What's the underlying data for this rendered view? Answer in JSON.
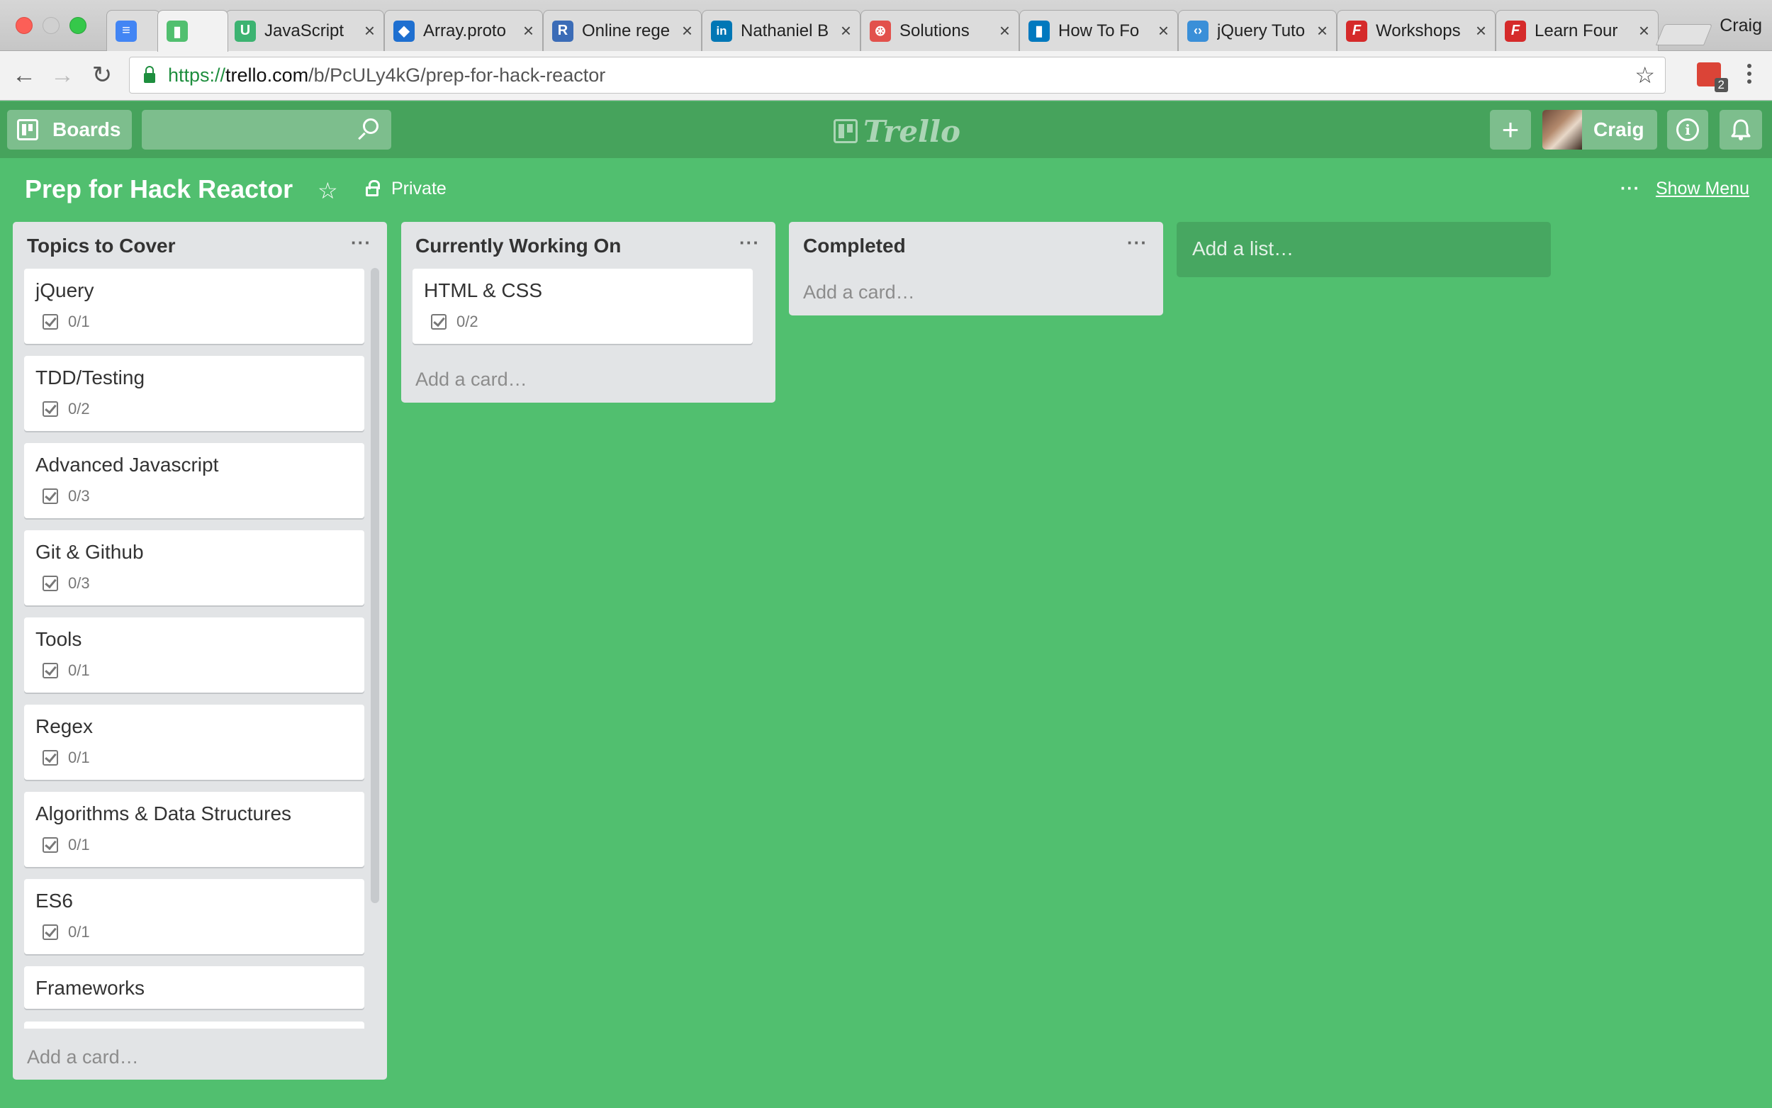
{
  "browser": {
    "tabs": [
      {
        "label": "",
        "icon": "google-docs-icon",
        "color": "#4285f4",
        "glyph": "≡"
      },
      {
        "label": "",
        "icon": "trello-icon",
        "color": "#51bf6f",
        "glyph": "▮"
      },
      {
        "label": "JavaScript",
        "icon": "udemy-icon",
        "color": "#3cb371",
        "glyph": "U"
      },
      {
        "label": "Array.proto",
        "icon": "mdn-icon",
        "color": "#1e6fd0",
        "glyph": "◆"
      },
      {
        "label": "Online rege",
        "icon": "regex-icon",
        "color": "#3b6cb7",
        "glyph": "R"
      },
      {
        "label": "Nathaniel B",
        "icon": "linkedin-icon",
        "color": "#0077b5",
        "glyph": "in"
      },
      {
        "label": "Solutions",
        "icon": "solutions-icon",
        "color": "#e2514c",
        "glyph": "⊛"
      },
      {
        "label": "How To Fo",
        "icon": "trello-icon",
        "color": "#0079bf",
        "glyph": "▮"
      },
      {
        "label": "jQuery Tuto",
        "icon": "jquery-code-icon",
        "color": "#3a8fd8",
        "glyph": "‹›"
      },
      {
        "label": "Workshops",
        "icon": "frontend-masters-icon",
        "color": "#d52a2a",
        "glyph": "F"
      },
      {
        "label": "Learn Four",
        "icon": "frontend-masters-icon",
        "color": "#d52a2a",
        "glyph": "F"
      }
    ],
    "profile_name": "Craig",
    "url": {
      "scheme": "https://",
      "host": "trello.com",
      "path": "/b/PcULy4kG/prep-for-hack-reactor"
    },
    "extension_badge": "2"
  },
  "header": {
    "boards_label": "Boards",
    "search_placeholder": "",
    "logo_text": "Trello",
    "add_label": "+",
    "user_name": "Craig",
    "info_label": "i"
  },
  "board": {
    "title": "Prep for Hack Reactor",
    "visibility": "Private",
    "show_menu_label": "Show Menu",
    "menu_dots": "···"
  },
  "lists": [
    {
      "title": "Topics to Cover",
      "menu": "···",
      "cards": [
        {
          "title": "jQuery",
          "checklist": "0/1"
        },
        {
          "title": "TDD/Testing",
          "checklist": "0/2"
        },
        {
          "title": "Advanced Javascript",
          "checklist": "0/3"
        },
        {
          "title": "Git & Github",
          "checklist": "0/3"
        },
        {
          "title": "Tools",
          "checklist": "0/1"
        },
        {
          "title": "Regex",
          "checklist": "0/1"
        },
        {
          "title": "Algorithms & Data Structures",
          "checklist": "0/1"
        },
        {
          "title": "ES6",
          "checklist": "0/1"
        },
        {
          "title": "Frameworks",
          "checklist": ""
        }
      ],
      "add_card": "Add a card…"
    },
    {
      "title": "Currently Working On",
      "menu": "···",
      "cards": [
        {
          "title": "HTML & CSS",
          "checklist": "0/2"
        }
      ],
      "add_card": "Add a card…"
    },
    {
      "title": "Completed",
      "menu": "···",
      "cards": [],
      "add_card": "Add a card…"
    }
  ],
  "add_list_label": "Add a list…",
  "colors": {
    "board_background": "#51bf6f",
    "header_background": "#46a35c",
    "list_background": "#e2e4e6"
  }
}
